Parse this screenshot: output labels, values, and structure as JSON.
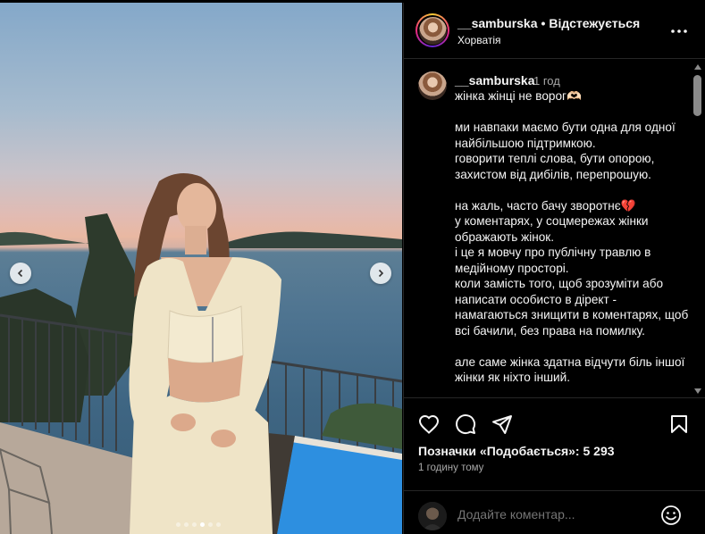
{
  "post": {
    "slides_count": 6,
    "active_slide": 4
  },
  "header": {
    "username": "__samburska",
    "separator": "•",
    "follow_label": "Відстежується",
    "location": "Хорватія"
  },
  "caption": {
    "username": "__samburska",
    "time": "1 год",
    "text": "жінка жінці не ворог🫶🏻\n\nми навпаки маємо бути одна для одної найбільшою підтримкою.\nговорити теплі слова, бути опорою, захистом від дибілів, перепрошую.\n\nна жаль, часто бачу зворотнє💔\nу коментарях, у соцмережах жінки ображають жінок.\nі це я мовчу про публічну травлю в медійному просторі.\nколи замість того, щоб зрозуміти або написати особисто в дірект - намагаються знищити в коментарях, щоб всі бачили, без права на помилку.\n\nале саме жінка здатна відчути біль іншої жінки як ніхто інший."
  },
  "actions": {
    "likes_text": "Позначки «Подобається»: 5 293",
    "posted_text": "1 годину тому"
  },
  "comment_box": {
    "placeholder": "Додайте коментар..."
  },
  "icons": {
    "prev": "chevron-left-icon",
    "next": "chevron-right-icon",
    "more": "more-horizontal-icon",
    "like": "heart-icon",
    "comment": "comment-icon",
    "share": "send-icon",
    "save": "bookmark-icon",
    "emoji": "emoji-icon"
  },
  "colors": {
    "background": "#000000",
    "text": "#f5f5f5",
    "muted": "#a8a8a8",
    "border": "#262626"
  }
}
